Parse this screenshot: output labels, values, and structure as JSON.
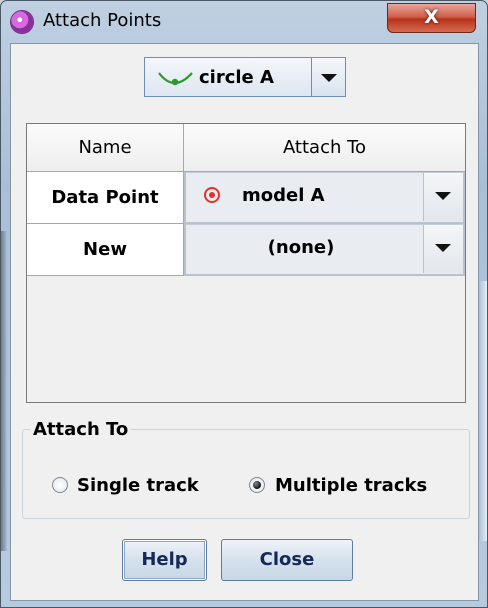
{
  "window": {
    "title": "Attach Points",
    "close_glyph": "X",
    "app_icon": "app-logo-icon"
  },
  "selector": {
    "value": "circle A",
    "icon": "curve-icon"
  },
  "table": {
    "headers": [
      "Name",
      "Attach To"
    ],
    "rows": [
      {
        "name": "Data Point",
        "attach_to": "model A",
        "icon": "target-icon"
      },
      {
        "name": "New",
        "attach_to": "(none)"
      }
    ]
  },
  "attach_group": {
    "title": "Attach To",
    "options": [
      {
        "label": "Single track",
        "selected": false
      },
      {
        "label": "Multiple tracks",
        "selected": true
      }
    ]
  },
  "buttons": {
    "help": "Help",
    "close": "Close"
  },
  "colors": {
    "target": "#e0332b",
    "curve": "#2a9a2a",
    "close_button": "#c9472f"
  }
}
